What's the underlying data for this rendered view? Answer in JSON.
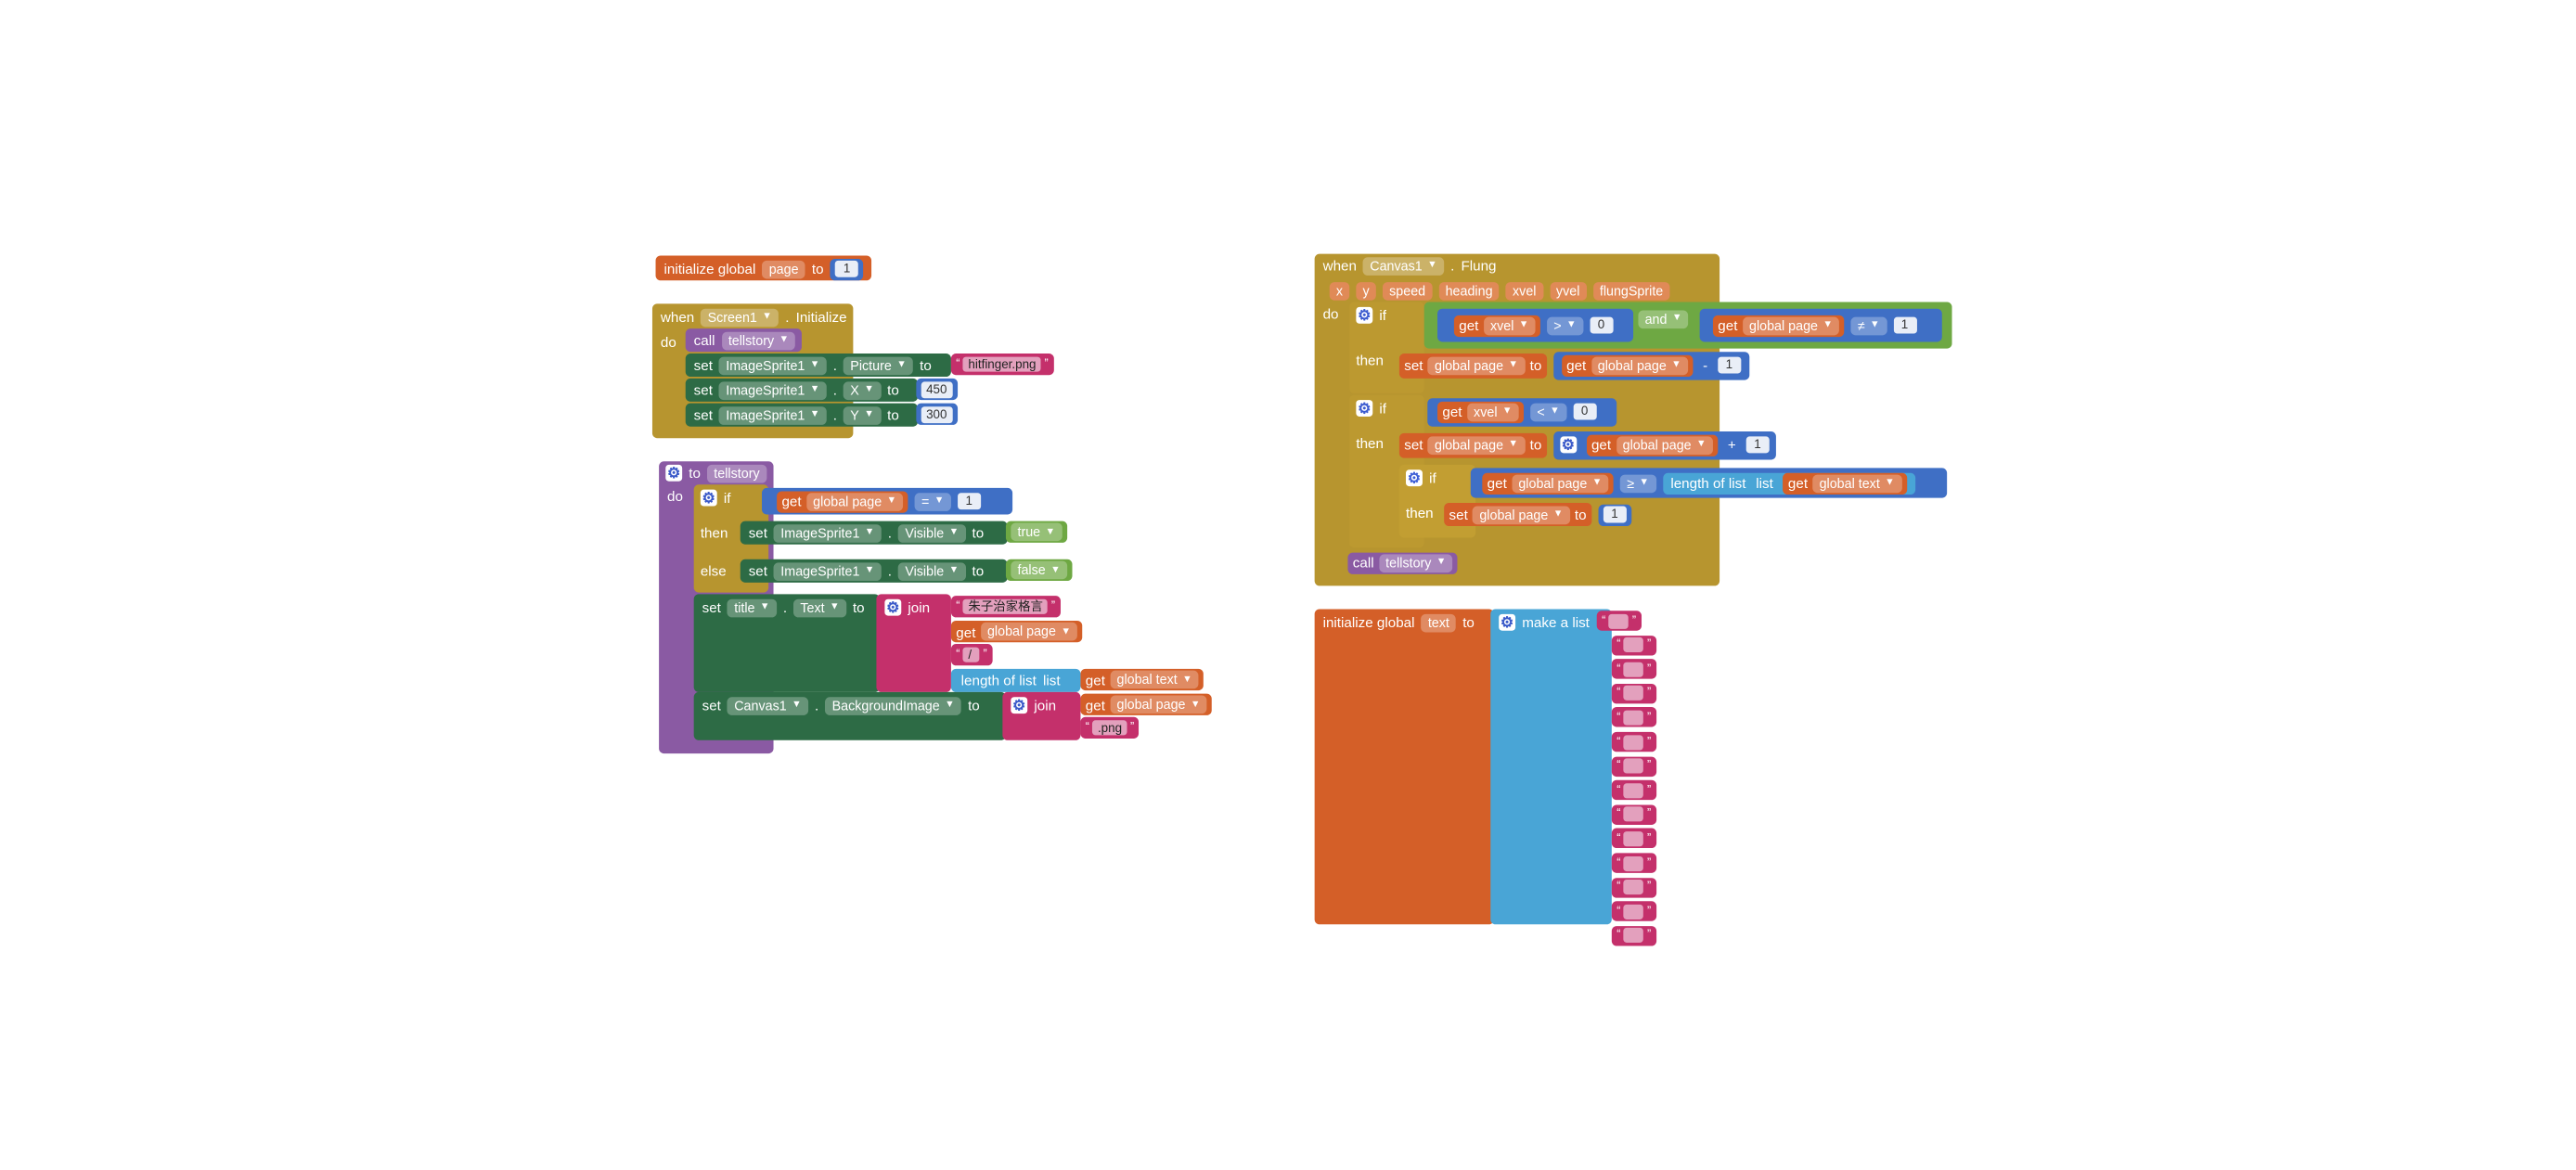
{
  "init_page": {
    "kw": "initialize global",
    "name": "page",
    "to": "to",
    "value": "1"
  },
  "screen_init": {
    "when": "when",
    "component": "Screen1",
    "event": "Initialize",
    "do": "do",
    "call": "call",
    "proc": "tellstory",
    "set": "set",
    "to": "to",
    "sprite": "ImageSprite1",
    "prop_picture": "Picture",
    "picture_value": "hitfinger.png",
    "prop_x": "X",
    "x_value": "450",
    "prop_y": "Y",
    "y_value": "300"
  },
  "tellstory": {
    "to": "to",
    "name": "tellstory",
    "do": "do",
    "if": "if",
    "then": "then",
    "else": "else",
    "get": "get",
    "var": "global page",
    "op_eq": "=",
    "one": "1",
    "set": "set",
    "sprite": "ImageSprite1",
    "prop_visible": "Visible",
    "true": "true",
    "false": "false",
    "title_comp": "title",
    "prop_text": "Text",
    "join": "join",
    "title_str": "朱子治家格言",
    "slash": "/",
    "length_of_list": "length of list",
    "list": "list",
    "text_var": "global text",
    "canvas": "Canvas1",
    "prop_bg": "BackgroundImage",
    "png": ".png"
  },
  "fling": {
    "when": "when",
    "component": "Canvas1",
    "event": "Flung",
    "params": [
      "x",
      "y",
      "speed",
      "heading",
      "xvel",
      "yvel",
      "flungSprite"
    ],
    "do": "do",
    "if": "if",
    "then": "then",
    "get": "get",
    "xvel": "xvel",
    "gt": ">",
    "zero": "0",
    "and": "and",
    "page_var": "global page",
    "neq": "≠",
    "one": "1",
    "set": "set",
    "to": "to",
    "minus": "-",
    "lt": "<",
    "plus": "+",
    "gte": "≥",
    "length_of_list": "length of list",
    "list": "list",
    "text_var": "global text",
    "call": "call",
    "proc": "tellstory"
  },
  "init_text": {
    "kw": "initialize global",
    "name": "text",
    "to": "to",
    "make_list": "make a list",
    "items": 14
  }
}
